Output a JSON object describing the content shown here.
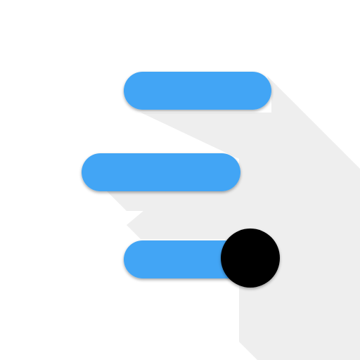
{
  "icon": {
    "name": "sliders-menu-icon",
    "colors": {
      "background": "#ffffff",
      "bar": "#42a5f5",
      "knob": "#000000",
      "long_shadow": "#eeeeee"
    }
  }
}
